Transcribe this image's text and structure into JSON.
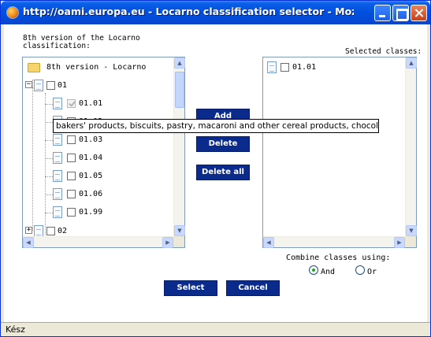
{
  "window": {
    "title": "http://oami.europa.eu - Locarno classification selector - Mozill..."
  },
  "left_panel": {
    "label_line1": "8th version of the Locarno",
    "label_line2": "classification:",
    "root_label": "8th version - Locarno",
    "tree": [
      {
        "label": "01",
        "checked": false,
        "expander": "−"
      },
      {
        "label": "01.01",
        "checked": true
      },
      {
        "label": "01.02",
        "checked": false
      },
      {
        "label": "01.03",
        "checked": false
      },
      {
        "label": "01.04",
        "checked": false
      },
      {
        "label": "01.05",
        "checked": false
      },
      {
        "label": "01.06",
        "checked": false
      },
      {
        "label": "01.99",
        "checked": false
      },
      {
        "label": "02",
        "checked": false,
        "expander": "+"
      }
    ]
  },
  "right_panel": {
    "label": "Selected classes:",
    "items": [
      {
        "label": "01.01",
        "checked": false
      }
    ]
  },
  "buttons": {
    "add": "Add",
    "delete": "Delete",
    "delete_all": "Delete all",
    "select": "Select",
    "cancel": "Cancel"
  },
  "tooltip": "bakers' products, biscuits, pastry, macaroni and other cereal products, chocolat",
  "combine": {
    "label": "Combine classes using:",
    "options": [
      {
        "label": "And",
        "selected": true
      },
      {
        "label": "Or",
        "selected": false
      }
    ]
  },
  "status": "Kész",
  "colors": {
    "titlebar": "#0351e0",
    "button_bg": "#0a2a8c",
    "list_border": "#7f9db9"
  }
}
